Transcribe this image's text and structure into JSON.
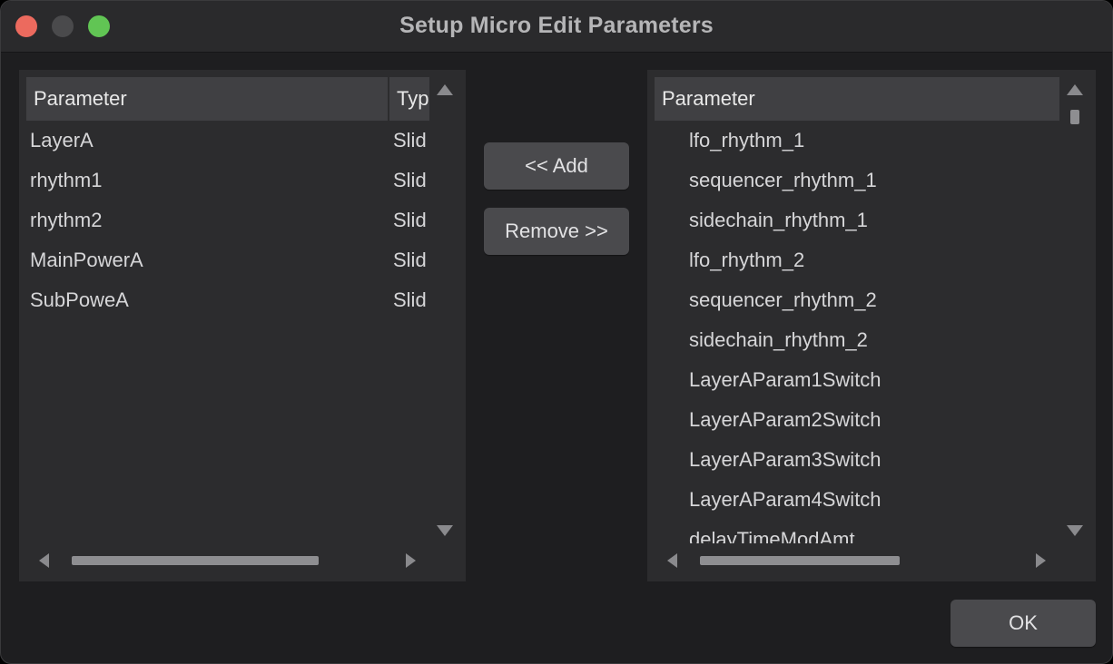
{
  "window": {
    "title": "Setup Micro Edit Parameters"
  },
  "left_list": {
    "columns": [
      "Parameter",
      "Typ"
    ],
    "rows": [
      {
        "name": "LayerA",
        "type": "Slid"
      },
      {
        "name": "rhythm1",
        "type": "Slid"
      },
      {
        "name": "rhythm2",
        "type": "Slid"
      },
      {
        "name": "MainPowerA",
        "type": "Slid"
      },
      {
        "name": "SubPoweA",
        "type": "Slid"
      }
    ]
  },
  "buttons": {
    "add": "<< Add",
    "remove": "Remove >>",
    "ok": "OK"
  },
  "right_list": {
    "column": "Parameter",
    "items": [
      "lfo_rhythm_1",
      "sequencer_rhythm_1",
      "sidechain_rhythm_1",
      "lfo_rhythm_2",
      "sequencer_rhythm_2",
      "sidechain_rhythm_2",
      "LayerAParam1Switch",
      "LayerAParam2Switch",
      "LayerAParam3Switch",
      "LayerAParam4Switch",
      "delayTimeModAmt"
    ]
  },
  "colors": {
    "traffic_close": "#ec6a5e",
    "traffic_min": "#4a4a4c",
    "traffic_max": "#61c554",
    "panel": "#2c2c2e",
    "header": "#404043"
  }
}
